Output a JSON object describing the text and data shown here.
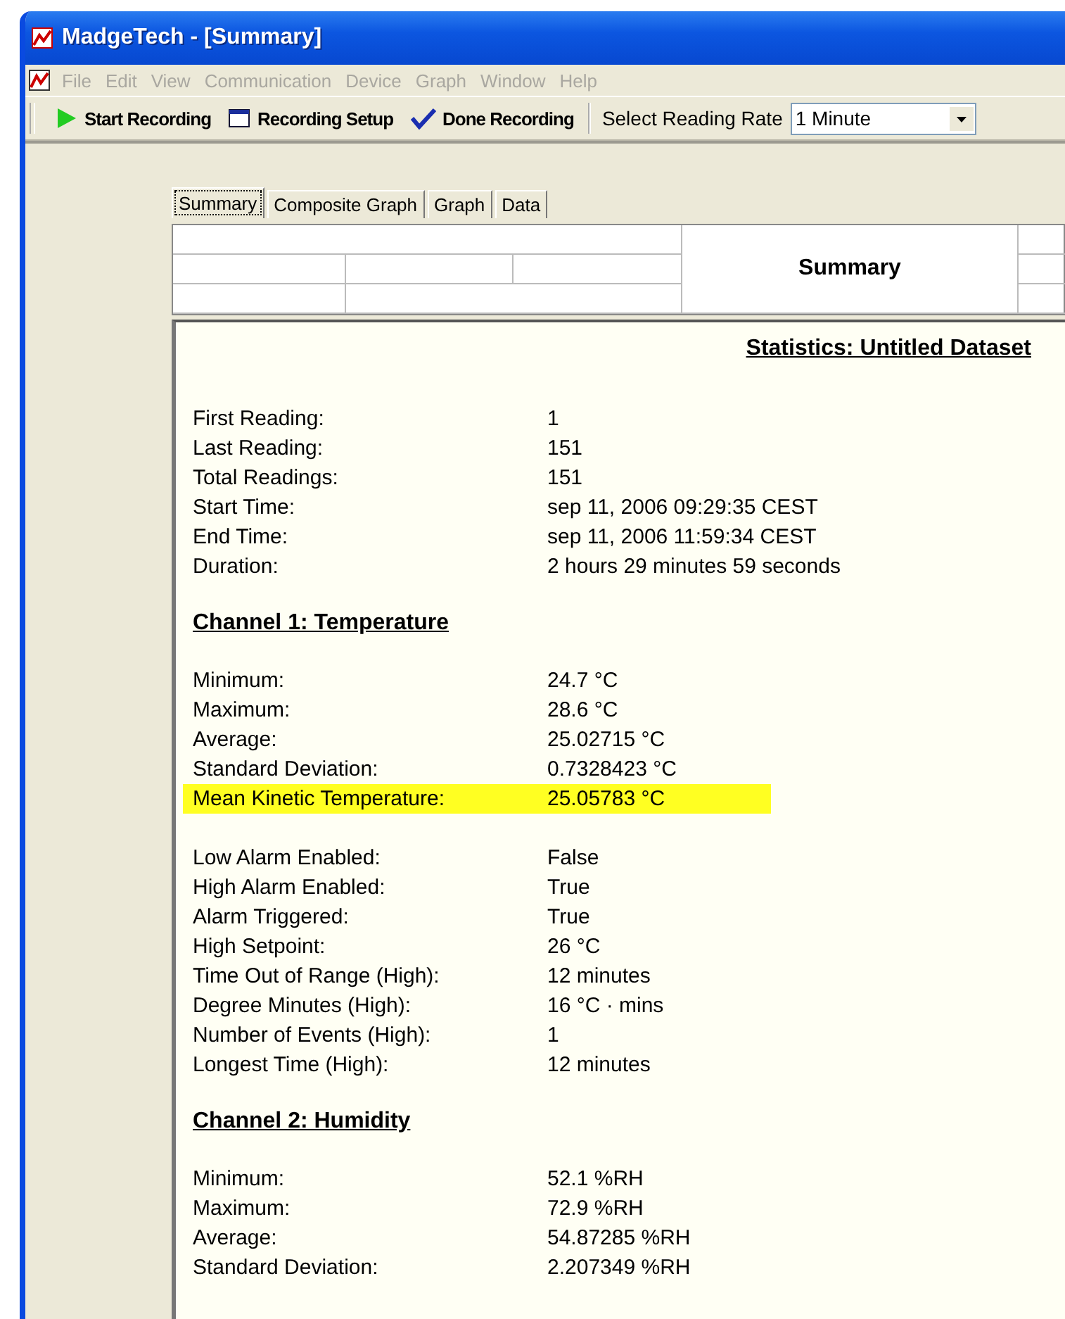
{
  "window": {
    "title": "MadgeTech - [Summary]"
  },
  "menu": [
    {
      "label": "File",
      "disabled": true
    },
    {
      "label": "Edit",
      "disabled": true
    },
    {
      "label": "View",
      "disabled": true
    },
    {
      "label": "Communication",
      "disabled": true
    },
    {
      "label": "Device",
      "disabled": true
    },
    {
      "label": "Graph",
      "disabled": true
    },
    {
      "label": "Window",
      "disabled": true
    },
    {
      "label": "Help",
      "disabled": true
    }
  ],
  "toolbar": {
    "buttons": [
      {
        "kind": "start",
        "label": "Start Recording"
      },
      {
        "kind": "setup",
        "label": "Recording Setup"
      },
      {
        "kind": "done",
        "label": "Done Recording"
      }
    ],
    "rate_label": "Select Reading Rate",
    "rate_value": "1 Minute"
  },
  "tabs": [
    {
      "label": "Summary",
      "selected": true
    },
    {
      "label": "Composite Graph",
      "selected": false
    },
    {
      "label": "Graph",
      "selected": false
    },
    {
      "label": "Data",
      "selected": false
    }
  ],
  "header": {
    "title": "Summary"
  },
  "report": {
    "title": "Statistics: Untitled Dataset",
    "blocks": [
      {
        "kind": "rows",
        "rows": [
          {
            "label": "First Reading:",
            "value": "1",
            "highlighted": false
          },
          {
            "label": "Last Reading:",
            "value": "151",
            "highlighted": false
          },
          {
            "label": "Total Readings:",
            "value": "151",
            "highlighted": false
          },
          {
            "label": "Start Time:",
            "value": "sep 11, 2006 09:29:35  CEST",
            "highlighted": false
          },
          {
            "label": "End Time:",
            "value": "sep 11, 2006 11:59:34  CEST",
            "highlighted": false
          },
          {
            "label": "Duration:",
            "value": "2 hours 29 minutes 59 seconds",
            "highlighted": false
          }
        ]
      },
      {
        "kind": "heading",
        "text": "Channel 1: Temperature"
      },
      {
        "kind": "rows",
        "rows": [
          {
            "label": "Minimum:",
            "value": "24.7 °C",
            "highlighted": false
          },
          {
            "label": "Maximum:",
            "value": "28.6 °C",
            "highlighted": false
          },
          {
            "label": "Average:",
            "value": "25.02715 °C",
            "highlighted": false
          },
          {
            "label": "Standard Deviation:",
            "value": "0.7328423 °C",
            "highlighted": false
          },
          {
            "label": "Mean Kinetic Temperature:",
            "value": "25.05783 °C",
            "highlighted": true
          }
        ]
      },
      {
        "kind": "rows",
        "rows": [
          {
            "label": "Low Alarm Enabled:",
            "value": "False",
            "highlighted": false
          },
          {
            "label": "High Alarm Enabled:",
            "value": "True",
            "highlighted": false
          },
          {
            "label": "Alarm Triggered:",
            "value": "True",
            "highlighted": false
          },
          {
            "label": "High Setpoint:",
            "value": "26 °C",
            "highlighted": false
          },
          {
            "label": "Time Out of Range (High):",
            "value": "12 minutes",
            "highlighted": false
          },
          {
            "label": "Degree Minutes (High):",
            "value": "16 °C · mins",
            "highlighted": false
          },
          {
            "label": "Number of Events (High):",
            "value": "1",
            "highlighted": false
          },
          {
            "label": "Longest Time (High):",
            "value": "12 minutes",
            "highlighted": false
          }
        ]
      },
      {
        "kind": "heading",
        "text": "Channel 2: Humidity"
      },
      {
        "kind": "rows",
        "rows": [
          {
            "label": "Minimum:",
            "value": "52.1 %RH",
            "highlighted": false
          },
          {
            "label": "Maximum:",
            "value": "72.9 %RH",
            "highlighted": false
          },
          {
            "label": "Average:",
            "value": "54.87285 %RH",
            "highlighted": false
          },
          {
            "label": "Standard Deviation:",
            "value": "2.207349 %RH",
            "highlighted": false
          }
        ]
      }
    ]
  }
}
